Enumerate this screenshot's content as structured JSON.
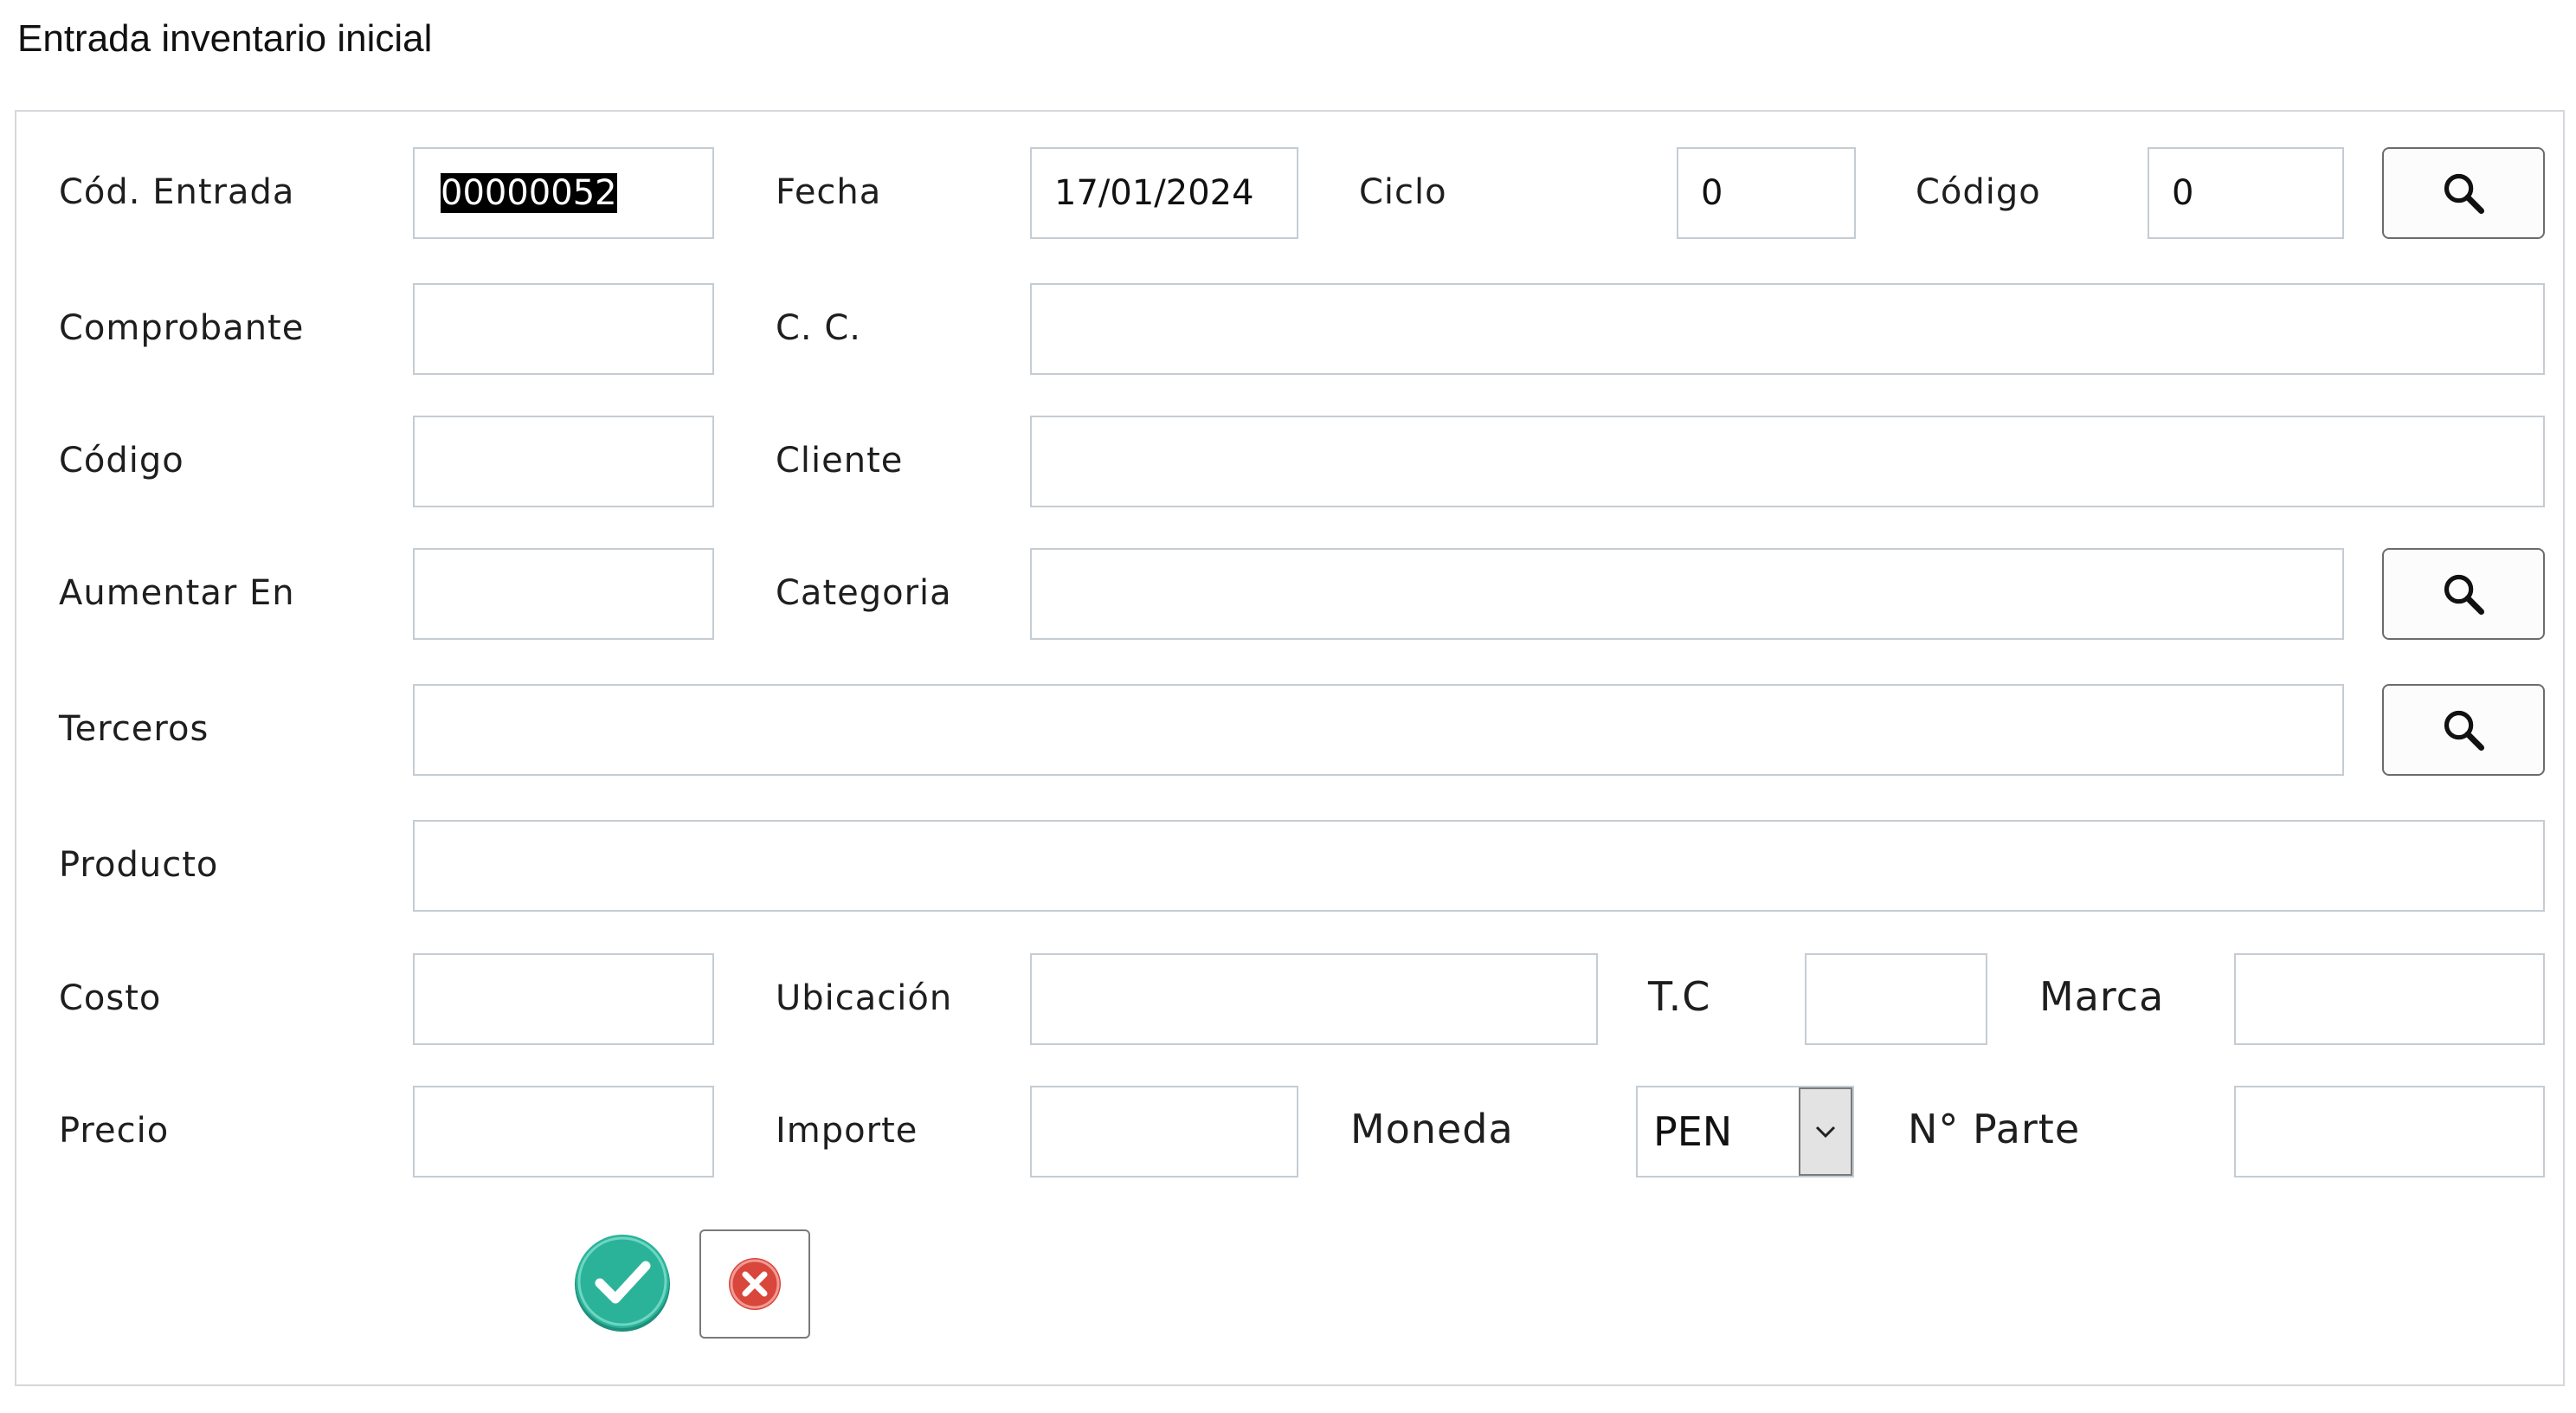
{
  "window": {
    "title": "Entrada inventario inicial"
  },
  "labels": {
    "cod_entrada": "Cód. Entrada",
    "fecha": "Fecha",
    "ciclo": "Ciclo",
    "codigo_top": "Código",
    "comprobante": "Comprobante",
    "cc": "C. C.",
    "codigo": "Código",
    "cliente": "Cliente",
    "aumentar_en": "Aumentar En",
    "categoria": "Categoria",
    "terceros": "Terceros",
    "producto": "Producto",
    "costo": "Costo",
    "ubicacion": "Ubicación",
    "tc": "T.C",
    "marca": "Marca",
    "precio": "Precio",
    "importe": "Importe",
    "moneda": "Moneda",
    "nro_parte": "N° Parte"
  },
  "values": {
    "cod_entrada": "00000052",
    "fecha": "17/01/2024",
    "ciclo": "0",
    "codigo_top": "0",
    "comprobante": "",
    "cc": "",
    "codigo": "",
    "cliente": "",
    "aumentar_en": "",
    "categoria": "",
    "terceros": "",
    "producto": "",
    "costo": "",
    "ubicacion": "",
    "tc": "",
    "marca": "",
    "precio": "",
    "importe": "",
    "moneda": "PEN",
    "nro_parte": ""
  },
  "icons": {
    "search": "search-icon",
    "confirm": "check-circle-icon",
    "cancel": "close-circle-icon",
    "dropdown": "chevron-down-icon"
  },
  "colors": {
    "confirm_green": "#2bb39a",
    "cancel_red": "#d9463c",
    "field_border": "#c5ccd3"
  }
}
